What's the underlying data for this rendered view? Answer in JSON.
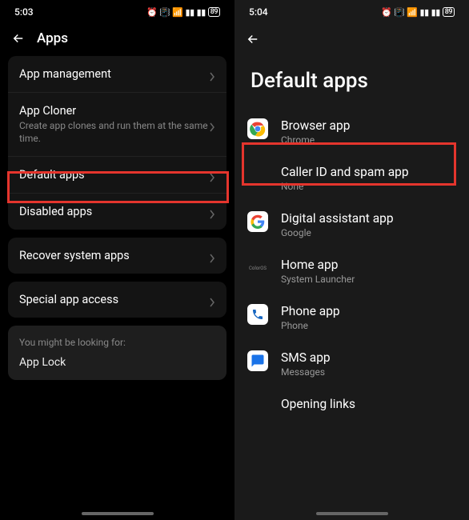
{
  "left": {
    "statusbar": {
      "time": "5:03",
      "battery": "89"
    },
    "header": {
      "title": "Apps"
    },
    "group1": [
      {
        "title": "App management",
        "sub": ""
      },
      {
        "title": "App Cloner",
        "sub": "Create app clones and run them at the same time."
      },
      {
        "title": "Default apps",
        "sub": ""
      },
      {
        "title": "Disabled apps",
        "sub": ""
      }
    ],
    "group2": [
      {
        "title": "Recover system apps",
        "sub": ""
      }
    ],
    "group3": [
      {
        "title": "Special app access",
        "sub": ""
      }
    ],
    "hint": {
      "prompt": "You might be looking for:",
      "link": "App Lock"
    }
  },
  "right": {
    "statusbar": {
      "time": "5:04",
      "battery": "89"
    },
    "title": "Default apps",
    "items": [
      {
        "icon": "chrome",
        "title": "Browser app",
        "sub": "Chrome"
      },
      {
        "icon": "blank",
        "title": "Caller ID and spam app",
        "sub": "None"
      },
      {
        "icon": "google",
        "title": "Digital assistant app",
        "sub": "Google"
      },
      {
        "icon": "color",
        "title": "Home app",
        "sub": "System Launcher"
      },
      {
        "icon": "phone",
        "title": "Phone app",
        "sub": "Phone"
      },
      {
        "icon": "sms",
        "title": "SMS app",
        "sub": "Messages"
      },
      {
        "icon": "blank",
        "title": "Opening links",
        "sub": ""
      }
    ]
  }
}
